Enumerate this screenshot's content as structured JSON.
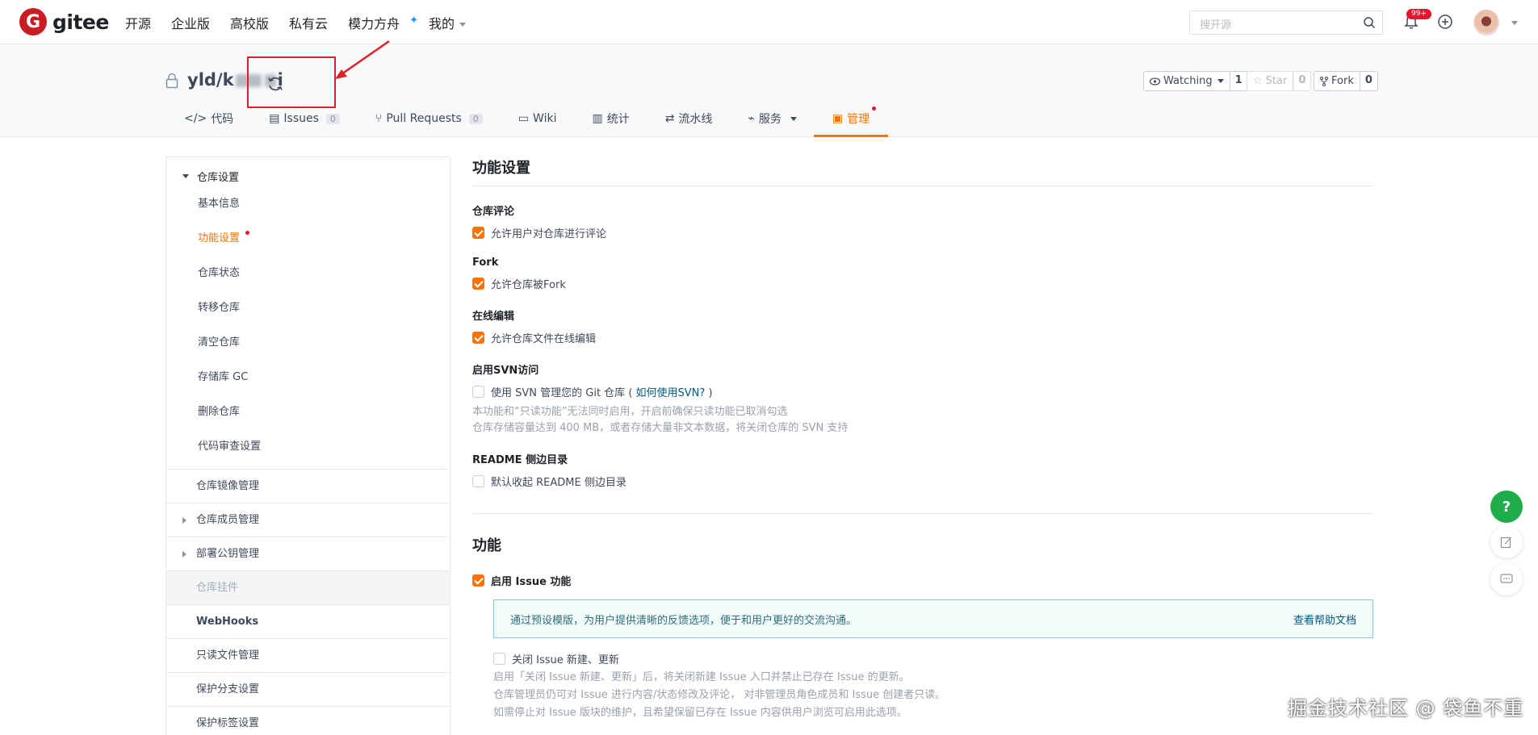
{
  "nav": {
    "logo_letter": "G",
    "logo_text": "gitee",
    "links": [
      "开源",
      "企业版",
      "高校版",
      "私有云",
      "模力方舟",
      "我的"
    ],
    "search_placeholder": "搜开源",
    "notify_badge": "99+"
  },
  "repo": {
    "title_owner": "yld/",
    "title_part1": "k",
    "title_part2": "i",
    "watching_label": "Watching",
    "watching_count": "1",
    "star_label": "Star",
    "star_count": "0",
    "fork_label": "Fork",
    "fork_count": "0"
  },
  "tabs": [
    {
      "label": "代码",
      "icon": "code-icon"
    },
    {
      "label": "Issues",
      "count": "0",
      "icon": "issue-icon"
    },
    {
      "label": "Pull Requests",
      "count": "0",
      "icon": "pr-icon"
    },
    {
      "label": "Wiki",
      "icon": "wiki-icon"
    },
    {
      "label": "统计",
      "icon": "chart-icon"
    },
    {
      "label": "流水线",
      "icon": "pipeline-icon"
    },
    {
      "label": "服务",
      "icon": "service-icon"
    },
    {
      "label": "管理",
      "icon": "manage-icon"
    }
  ],
  "sidebar": {
    "group_title": "仓库设置",
    "items": [
      "基本信息",
      "功能设置",
      "仓库状态",
      "转移仓库",
      "清空仓库",
      "存储库 GC",
      "删除仓库",
      "代码审查设置"
    ],
    "rows": [
      "仓库镜像管理",
      "仓库成员管理",
      "部署公钥管理",
      "仓库挂件",
      "WebHooks",
      "只读文件管理",
      "保护分支设置",
      "保护标签设置"
    ]
  },
  "main": {
    "section1_title": "功能设置",
    "comment_label": "仓库评论",
    "comment_option": "允许用户对仓库进行评论",
    "fork_label": "Fork",
    "fork_option": "允许仓库被Fork",
    "online_label": "在线编辑",
    "online_option": "允许仓库文件在线编辑",
    "svn_label": "启用SVN访问",
    "svn_option_prefix": "使用 SVN 管理您的 Git 仓库 (",
    "svn_link": "如何使用SVN?",
    "svn_option_suffix": ")",
    "svn_hint1": "本功能和“只读功能”无法同时启用，开启前确保只读功能已取消勾选",
    "svn_hint2": "仓库存储容量达到 400 MB，或者存储大量非文本数据，将关闭仓库的 SVN 支持",
    "readme_label": "README 侧边目录",
    "readme_option": "默认收起 README 侧边目录",
    "section2_title": "功能",
    "issue_option": "启用 Issue 功能",
    "info_text": "通过预设模版，为用户提供清晰的反馈选项，便于和用户更好的交流沟通。",
    "info_link": "查看帮助文档",
    "close_issue_option": "关闭 Issue 新建、更新",
    "close_hint1": "启用「关闭 Issue 新建、更新」后，将关闭新建 Issue 入口并禁止已存在 Issue 的更新。",
    "close_hint2": "仓库管理员仍可对 Issue 进行内容/状态修改及评论， 对非管理员角色成员和 Issue 创建者只读。",
    "close_hint3": "如需停止对 Issue 版块的维护，且希望保留已存在 Issue 内容供用户浏览可启用此选项。"
  },
  "float": {
    "help_label": "?"
  },
  "watermark": "掘金技术社区 @ 袋鱼不重"
}
